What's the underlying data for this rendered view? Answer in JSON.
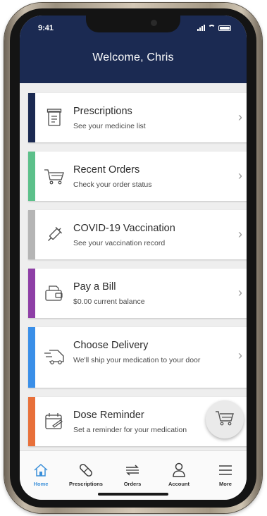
{
  "status_bar": {
    "time": "9:41"
  },
  "header": {
    "title": "Welcome, Chris"
  },
  "cards": [
    {
      "title": "Prescriptions",
      "subtitle": "See your medicine list",
      "accent": "#1b2a52",
      "icon": "prescription-list-icon"
    },
    {
      "title": "Recent Orders",
      "subtitle": "Check your order status",
      "accent": "#5cc08a",
      "icon": "cart-icon"
    },
    {
      "title": "COVID-19 Vaccination",
      "subtitle": "See your vaccination record",
      "accent": "#b5b5b5",
      "icon": "syringe-icon"
    },
    {
      "title": "Pay a Bill",
      "subtitle": "$0.00 current balance",
      "accent": "#8e3fa6",
      "icon": "bill-payment-icon"
    },
    {
      "title": "Choose Delivery",
      "subtitle": "We'll ship your medication to your door",
      "accent": "#3a8fe8",
      "icon": "delivery-truck-icon"
    },
    {
      "title": "Dose Reminder",
      "subtitle": "Set a reminder for your medication",
      "accent": "#e8703a",
      "icon": "calendar-reminder-icon"
    }
  ],
  "tabbar": {
    "items": [
      {
        "label": "Home",
        "icon": "home-icon",
        "active": true
      },
      {
        "label": "Prescriptions",
        "icon": "pill-icon",
        "active": false
      },
      {
        "label": "Orders",
        "icon": "orders-icon",
        "active": false
      },
      {
        "label": "Account",
        "icon": "person-icon",
        "active": false
      },
      {
        "label": "More",
        "icon": "menu-icon",
        "active": false
      }
    ]
  },
  "fab": {
    "icon": "cart-icon"
  },
  "colors": {
    "header_bg": "#1b2a52",
    "active_tab": "#3a8fd9",
    "screen_bg": "#eeeeee"
  }
}
